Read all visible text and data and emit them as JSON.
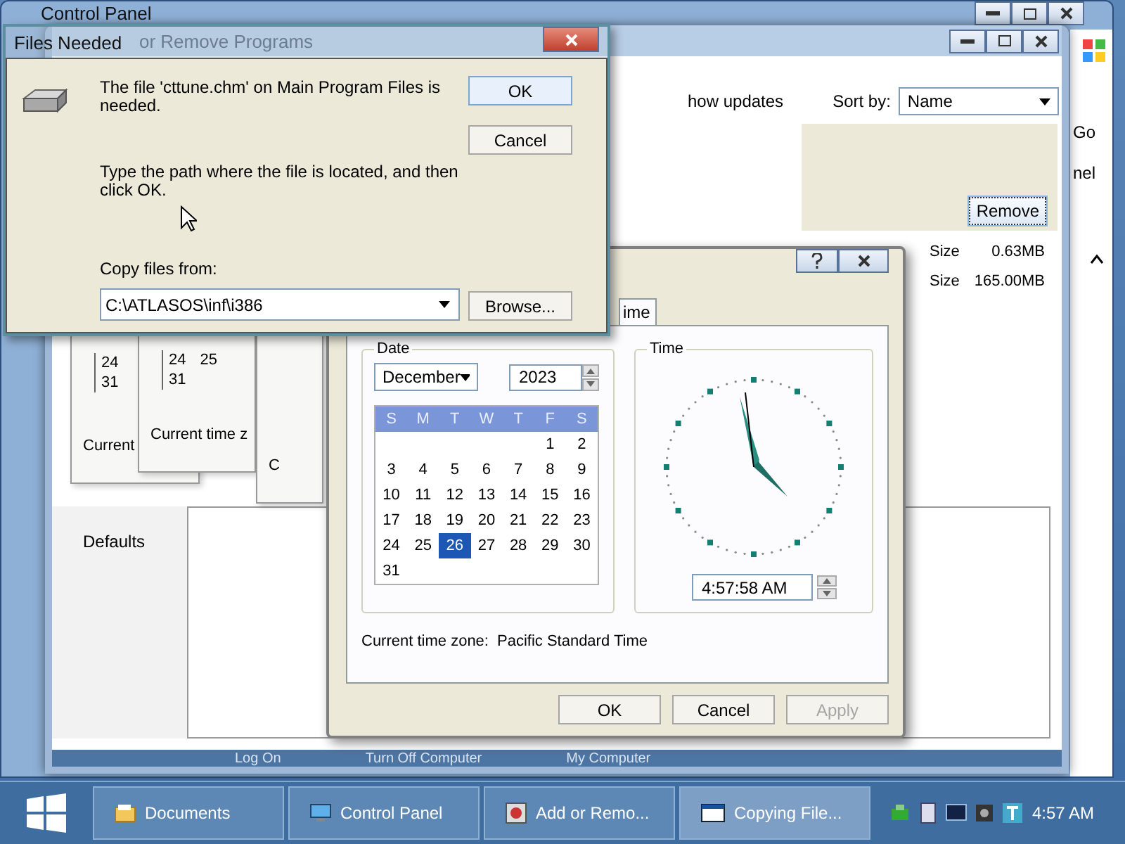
{
  "control_panel": {
    "title": "Control Panel",
    "side_texts": [
      "Go",
      "nel"
    ]
  },
  "add_remove": {
    "title": "or Remove Programs",
    "show_updates": "how updates",
    "sort_label": "Sort by:",
    "sort_value": "Name",
    "remove_button": "Remove",
    "sizes": [
      {
        "label": "Size",
        "value": "0.63MB"
      },
      {
        "label": "Size",
        "value": "165.00MB"
      }
    ],
    "sidebar_item": "Defaults",
    "footer": [
      "Log On",
      "Turn Off Computer",
      "My Computer"
    ]
  },
  "ghosts": [
    {
      "lines": [
        [
          "24"
        ],
        [
          "31"
        ]
      ],
      "caption": "Current"
    },
    {
      "lines": [
        [
          "24",
          "25"
        ],
        [
          "31"
        ]
      ],
      "caption": "Current time z"
    },
    {
      "caption": "C"
    }
  ],
  "files_dialog": {
    "title": "Files Needed",
    "message": "The file 'cttune.chm' on Main Program Files is needed.",
    "instruction": "Type the path where the file is located, and then click OK.",
    "copy_label": "Copy files from:",
    "path": "C:\\ATLASOS\\inf\\i386",
    "ok": "OK",
    "cancel": "Cancel",
    "browse": "Browse..."
  },
  "datetime_dialog": {
    "tab": "ime",
    "date_group": "Date",
    "month": "December",
    "year": "2023",
    "weekdays": [
      "S",
      "M",
      "T",
      "W",
      "T",
      "F",
      "S"
    ],
    "weeks": [
      {
        "days": [
          {
            "label": "1",
            "selected": false
          },
          {
            "label": "2",
            "selected": false
          }
        ]
      },
      {
        "days": [
          {
            "label": "3",
            "selected": false
          },
          {
            "label": "4",
            "selected": false
          },
          {
            "label": "5",
            "selected": false
          },
          {
            "label": "6",
            "selected": false
          },
          {
            "label": "7",
            "selected": false
          },
          {
            "label": "8",
            "selected": false
          },
          {
            "label": "9",
            "selected": false
          }
        ]
      },
      {
        "days": [
          {
            "label": "10",
            "selected": false
          },
          {
            "label": "11",
            "selected": false
          },
          {
            "label": "12",
            "selected": false
          },
          {
            "label": "13",
            "selected": false
          },
          {
            "label": "14",
            "selected": false
          },
          {
            "label": "15",
            "selected": false
          },
          {
            "label": "16",
            "selected": false
          }
        ]
      },
      {
        "days": [
          {
            "label": "17",
            "selected": false
          },
          {
            "label": "18",
            "selected": false
          },
          {
            "label": "19",
            "selected": false
          },
          {
            "label": "20",
            "selected": false
          },
          {
            "label": "21",
            "selected": false
          },
          {
            "label": "22",
            "selected": false
          },
          {
            "label": "23",
            "selected": false
          }
        ]
      },
      {
        "days": [
          {
            "label": "24",
            "selected": false
          },
          {
            "label": "25",
            "selected": false
          },
          {
            "label": "26",
            "selected": true
          },
          {
            "label": "27",
            "selected": false
          },
          {
            "label": "28",
            "selected": false
          },
          {
            "label": "29",
            "selected": false
          },
          {
            "label": "30",
            "selected": false
          }
        ]
      },
      {
        "days": [
          {
            "label": "31",
            "selected": false
          }
        ]
      }
    ],
    "time_group": "Time",
    "time": "4:57:58 AM",
    "timezone_label": "Current time zone:",
    "timezone": "Pacific Standard Time",
    "buttons": [
      {
        "label": "OK",
        "disabled": false
      },
      {
        "label": "Cancel",
        "disabled": false
      },
      {
        "label": "Apply",
        "disabled": true
      }
    ]
  },
  "taskbar": {
    "tasks": [
      {
        "label": "Documents",
        "selected": false
      },
      {
        "label": "Control Panel",
        "selected": false
      },
      {
        "label": "Add or Remo...",
        "selected": false
      },
      {
        "label": "Copying File...",
        "selected": true
      }
    ],
    "clock": "4:57 AM"
  }
}
